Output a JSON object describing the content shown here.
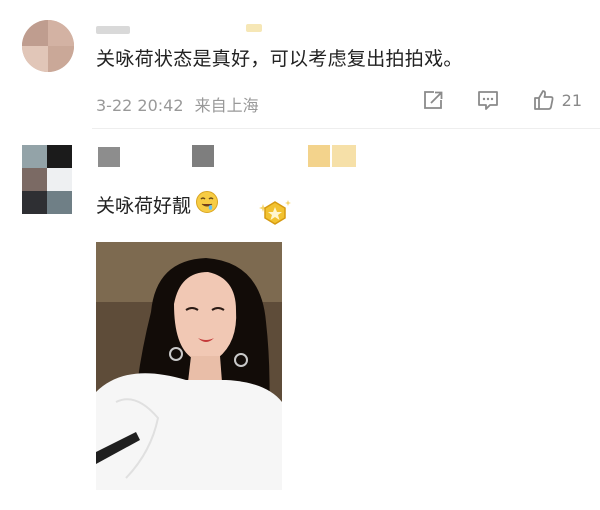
{
  "comments": [
    {
      "text": "关咏荷状态是真好，可以考虑复出拍拍戏。",
      "time": "3-22 20:42",
      "location": "来自上海",
      "likes": "21",
      "icons": [
        "share-icon",
        "reply-icon",
        "like-icon"
      ]
    },
    {
      "text": "关咏荷好靓",
      "emoji": "drooling-face-emoji",
      "badge": "gold-fan-badge-icon",
      "image": "woman-portrait-photo"
    }
  ],
  "colors": {
    "meta_text": "#999999",
    "icon_gray": "#8a8a8a",
    "badge_gold": "#f2c230"
  }
}
